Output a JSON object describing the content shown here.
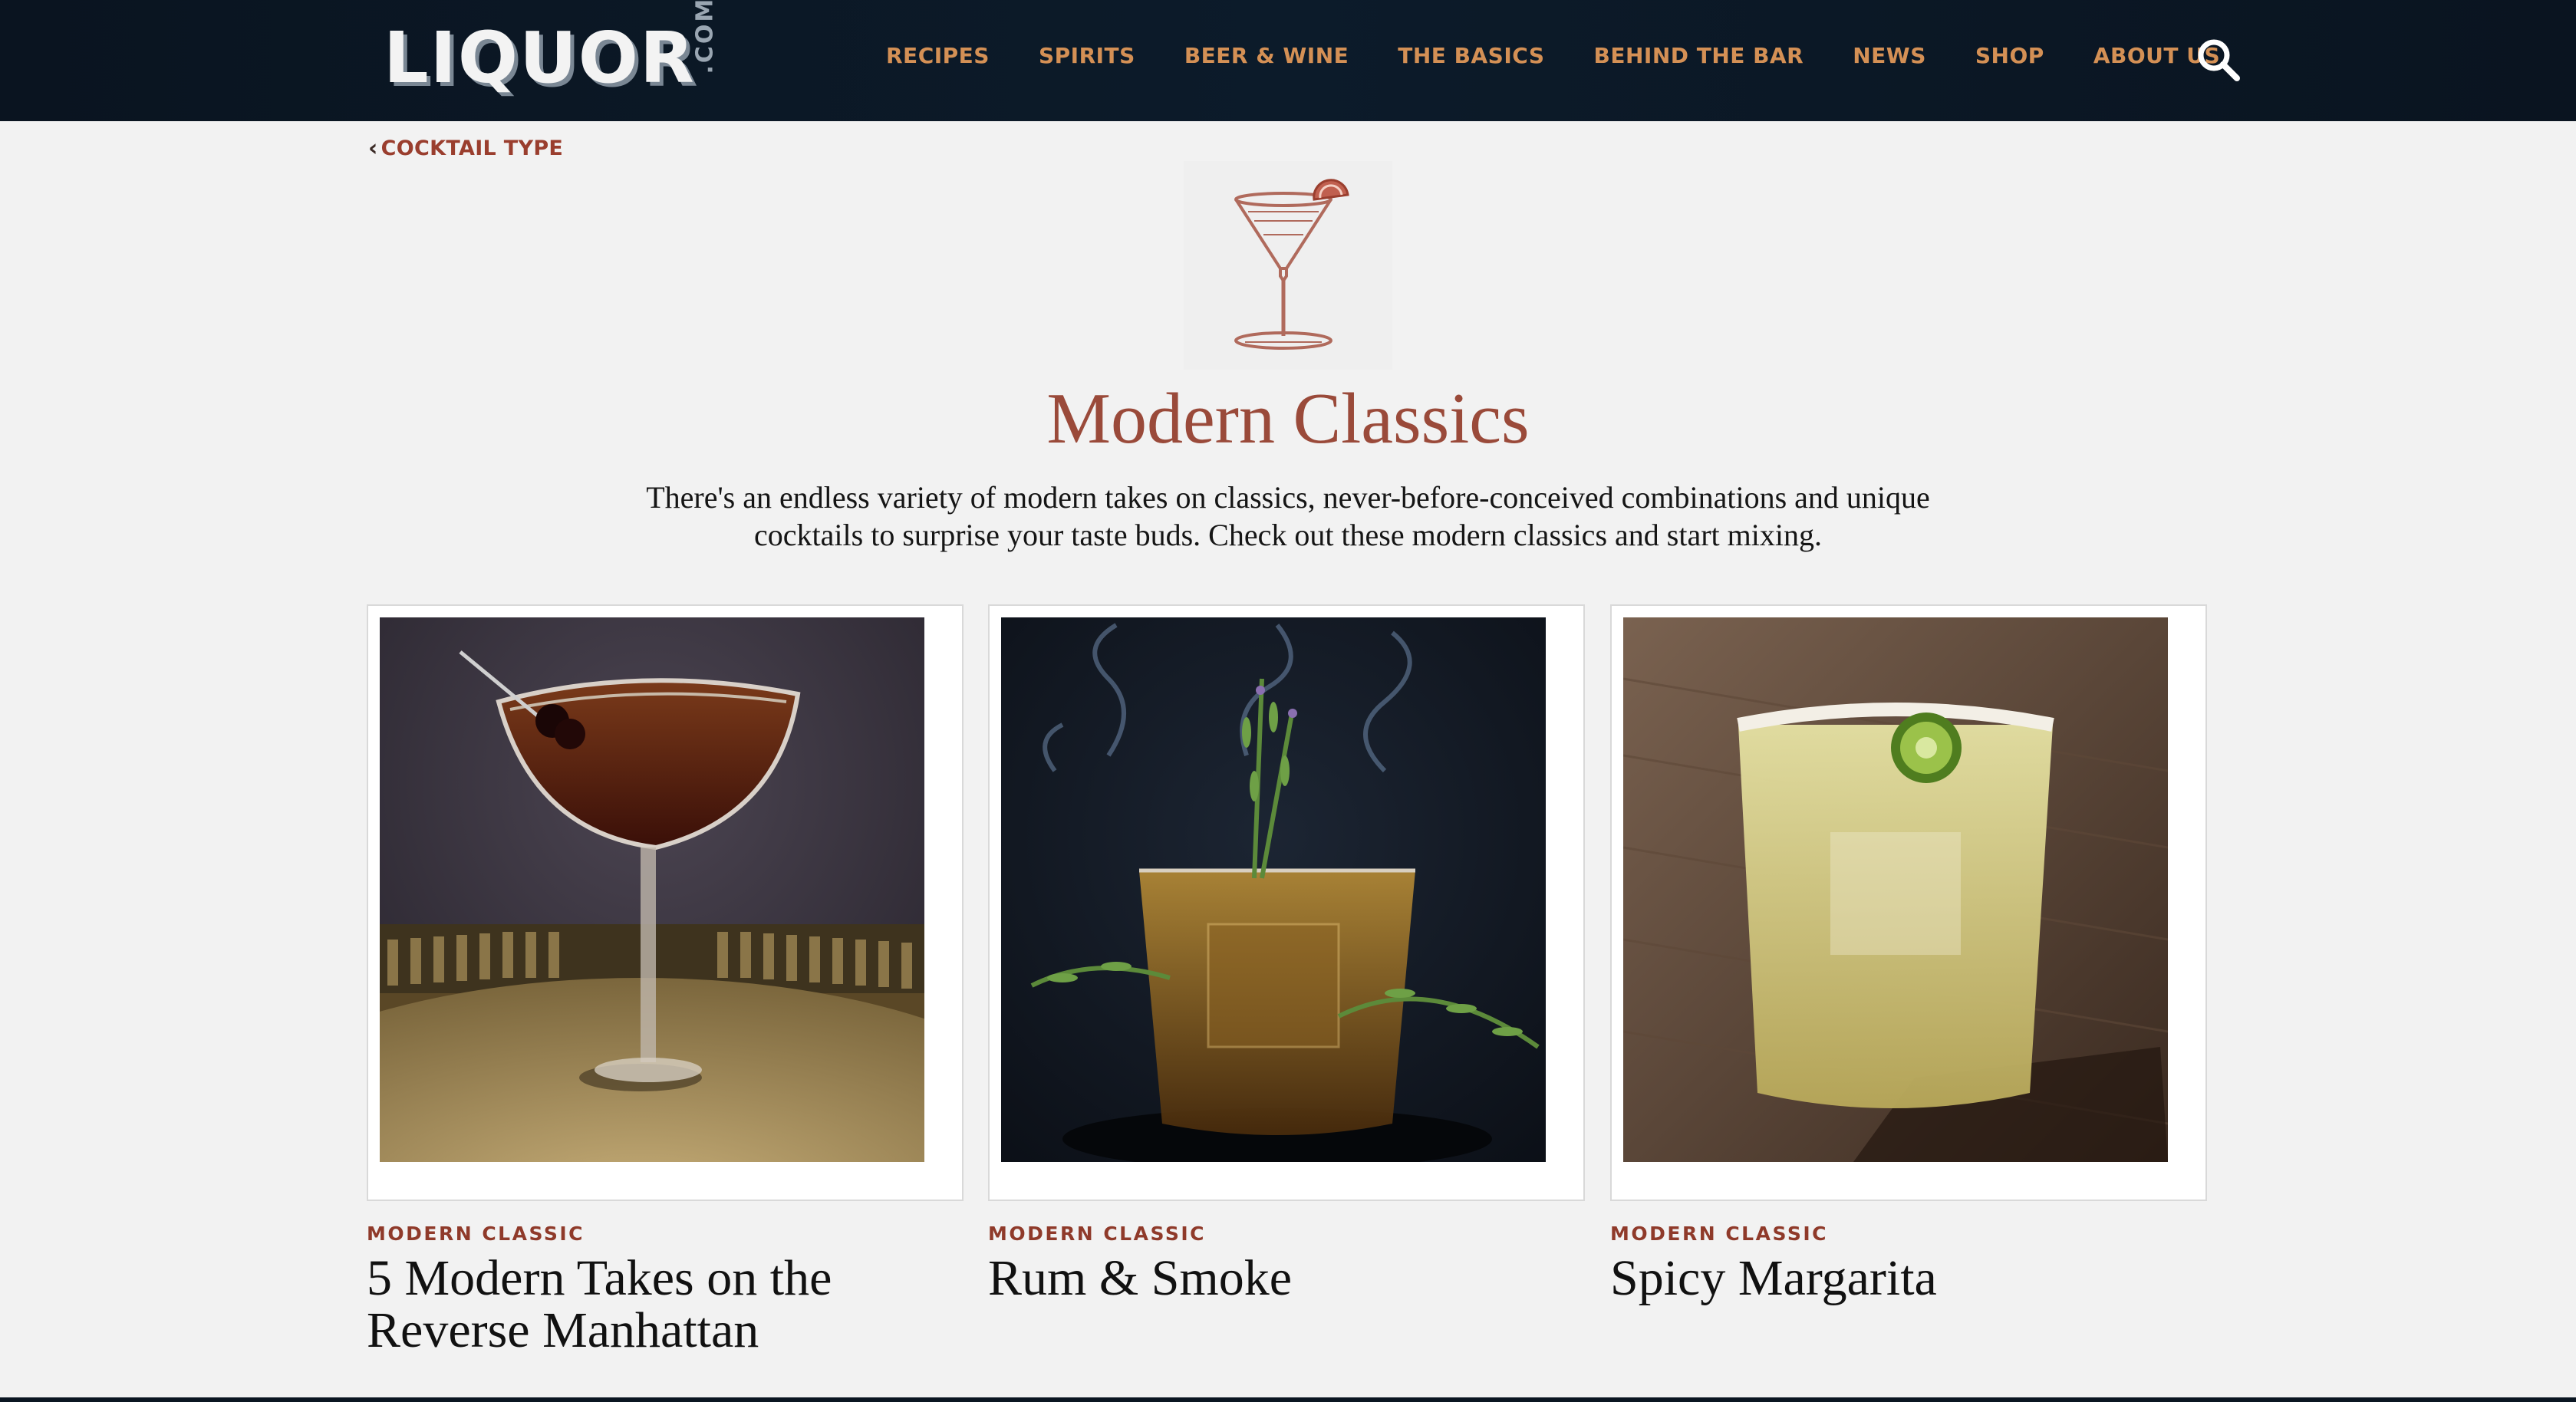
{
  "header": {
    "logo_text": "LIQUOR",
    "logo_suffix": ".COM",
    "nav": [
      "RECIPES",
      "SPIRITS",
      "BEER & WINE",
      "THE BASICS",
      "BEHIND THE BAR",
      "NEWS",
      "SHOP",
      "ABOUT US"
    ],
    "search_icon": "search-icon"
  },
  "breadcrumb": {
    "label": "COCKTAIL TYPE",
    "icon": "chevron-left-icon"
  },
  "page": {
    "title": "Modern Classics",
    "intro": "There's an endless variety of modern takes on classics, never-before-conceived combinations and unique cocktails to surprise your taste buds. Check out these modern classics and start mixing."
  },
  "cards": [
    {
      "tag": "MODERN CLASSIC",
      "title": "5 Modern Takes on the Reverse Manhattan"
    },
    {
      "tag": "MODERN CLASSIC",
      "title": "Rum & Smoke"
    },
    {
      "tag": "MODERN CLASSIC",
      "title": "Spicy Margarita"
    }
  ],
  "colors": {
    "nav_text": "#d49055",
    "accent": "#9a4a3a",
    "tag": "#8f3a2a",
    "header_bg": "#0b1622",
    "page_bg": "#f2f2f2"
  }
}
